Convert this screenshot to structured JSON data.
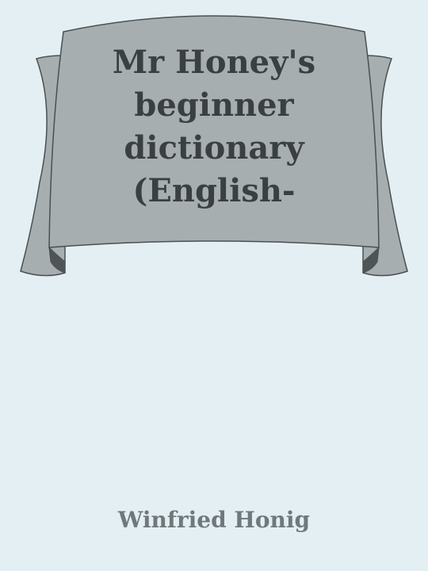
{
  "book": {
    "title_lines": [
      "Mr Honey's",
      "beginner",
      "dictionary",
      "(English-"
    ],
    "author": "Winfried Honig"
  },
  "colors": {
    "background": "#e4eff4",
    "banner_fill": "#a7aeb0",
    "banner_outline": "#4a5052",
    "banner_fold": "#4f5557",
    "title_text": "#3a3f42",
    "author_text": "#6f797b"
  }
}
